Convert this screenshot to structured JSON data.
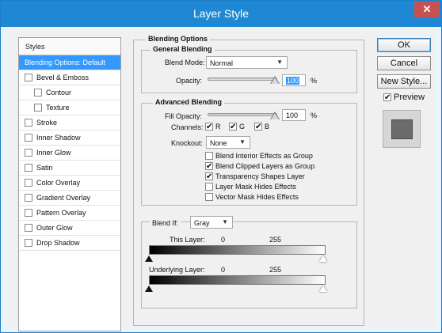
{
  "window": {
    "title": "Layer Style",
    "close_glyph": "✕"
  },
  "styles_panel": {
    "header": "Styles",
    "items": [
      {
        "label": "Blending Options: Default",
        "selected": true,
        "checkbox": false,
        "indent": false,
        "checked": false
      },
      {
        "label": "Bevel & Emboss",
        "selected": false,
        "checkbox": true,
        "indent": false,
        "checked": false
      },
      {
        "label": "Contour",
        "selected": false,
        "checkbox": true,
        "indent": true,
        "checked": false
      },
      {
        "label": "Texture",
        "selected": false,
        "checkbox": true,
        "indent": true,
        "checked": false
      },
      {
        "label": "Stroke",
        "selected": false,
        "checkbox": true,
        "indent": false,
        "checked": false
      },
      {
        "label": "Inner Shadow",
        "selected": false,
        "checkbox": true,
        "indent": false,
        "checked": false
      },
      {
        "label": "Inner Glow",
        "selected": false,
        "checkbox": true,
        "indent": false,
        "checked": false
      },
      {
        "label": "Satin",
        "selected": false,
        "checkbox": true,
        "indent": false,
        "checked": false
      },
      {
        "label": "Color Overlay",
        "selected": false,
        "checkbox": true,
        "indent": false,
        "checked": false
      },
      {
        "label": "Gradient Overlay",
        "selected": false,
        "checkbox": true,
        "indent": false,
        "checked": false
      },
      {
        "label": "Pattern Overlay",
        "selected": false,
        "checkbox": true,
        "indent": false,
        "checked": false
      },
      {
        "label": "Outer Glow",
        "selected": false,
        "checkbox": true,
        "indent": false,
        "checked": false
      },
      {
        "label": "Drop Shadow",
        "selected": false,
        "checkbox": true,
        "indent": false,
        "checked": false
      }
    ]
  },
  "blending_options": {
    "title": "Blending Options",
    "general": {
      "title": "General Blending",
      "blend_mode_label": "Blend Mode:",
      "blend_mode_value": "Normal",
      "opacity_label": "Opacity:",
      "opacity_value": "100",
      "opacity_unit": "%",
      "opacity_fraction": 1.0
    },
    "advanced": {
      "title": "Advanced Blending",
      "fill_opacity_label": "Fill Opacity:",
      "fill_opacity_value": "100",
      "fill_opacity_unit": "%",
      "fill_opacity_fraction": 1.0,
      "channels_label": "Channels:",
      "channels": [
        {
          "label": "R",
          "checked": true
        },
        {
          "label": "G",
          "checked": true
        },
        {
          "label": "B",
          "checked": true
        }
      ],
      "knockout_label": "Knockout:",
      "knockout_value": "None",
      "options": [
        {
          "label": "Blend Interior Effects as Group",
          "checked": false
        },
        {
          "label": "Blend Clipped Layers as Group",
          "checked": true
        },
        {
          "label": "Transparency Shapes Layer",
          "checked": true
        },
        {
          "label": "Layer Mask Hides Effects",
          "checked": false
        },
        {
          "label": "Vector Mask Hides Effects",
          "checked": false
        }
      ]
    },
    "blend_if": {
      "label": "Blend If:",
      "value": "Gray",
      "this_layer_label": "This Layer:",
      "this_layer_min": "0",
      "this_layer_max": "255",
      "underlying_label": "Underlying Layer:",
      "underlying_min": "0",
      "underlying_max": "255"
    }
  },
  "buttons": {
    "ok": "OK",
    "cancel": "Cancel",
    "new_style": "New Style...",
    "preview_label": "Preview",
    "preview_checked": true
  },
  "colors": {
    "titlebar": "#1e88d4",
    "selection": "#3399ff",
    "close": "#c75050"
  }
}
